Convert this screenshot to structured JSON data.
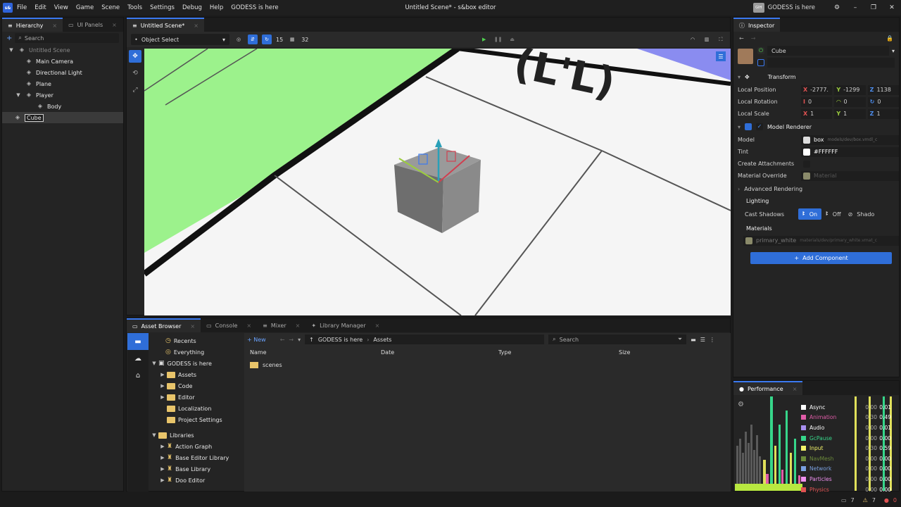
{
  "app": {
    "logo": "s&",
    "title": "Untitled Scene* - s&box editor",
    "user": "GODESS is here",
    "avatar": "GIH"
  },
  "menu": [
    "File",
    "Edit",
    "View",
    "Game",
    "Scene",
    "Tools",
    "Settings",
    "Debug",
    "Help",
    "GODESS is here"
  ],
  "hierarchy": {
    "tabs": [
      "Hierarchy",
      "UI Panels"
    ],
    "search_placeholder": "Search",
    "items": [
      {
        "label": "Untitled Scene"
      },
      {
        "label": "Main Camera"
      },
      {
        "label": "Directional Light"
      },
      {
        "label": "Plane"
      },
      {
        "label": "Player"
      },
      {
        "label": "Body"
      },
      {
        "label": "Cube"
      }
    ]
  },
  "viewport": {
    "tab": "Untitled Scene*",
    "mode": "Object Select",
    "snap": "15",
    "grid": "32"
  },
  "bottom": {
    "tabs": [
      "Asset Browser",
      "Console",
      "Mixer",
      "Library Manager"
    ],
    "new_label": "New",
    "path": [
      "GODESS is here",
      "Assets"
    ],
    "search_placeholder": "Search",
    "columns": [
      "Name",
      "Date",
      "Type",
      "Size"
    ],
    "files": [
      "scenes"
    ],
    "tree": {
      "recents": "Recents",
      "everything": "Everything",
      "project": "GODESS is here",
      "project_items": [
        "Assets",
        "Code",
        "Editor",
        "Localization",
        "Project Settings"
      ],
      "libraries": "Libraries",
      "library_items": [
        "Action Graph",
        "Base Editor Library",
        "Base Library",
        "Doo Editor"
      ]
    }
  },
  "inspector": {
    "tab": "Inspector",
    "object_name": "Cube",
    "transform": {
      "title": "Transform",
      "pos_label": "Local Position",
      "pos": [
        "-2777.",
        "-1299",
        "1138"
      ],
      "rot_label": "Local Rotation",
      "rot": [
        "0",
        "0",
        "0"
      ],
      "scale_label": "Local Scale",
      "scale": [
        "1",
        "1",
        "1"
      ]
    },
    "renderer": {
      "title": "Model Renderer",
      "model_label": "Model",
      "model_name": "box",
      "model_path": "models/dev/box.vmdl_c",
      "tint_label": "Tint",
      "tint": "#FFFFFF",
      "attach_label": "Create Attachments",
      "matov_label": "Material Override",
      "matov_placeholder": "Material",
      "advanced": "Advanced Rendering",
      "lighting": "Lighting",
      "shadows_label": "Cast Shadows",
      "shadow_on": "On",
      "shadow_off": "Off",
      "shadow_only": "Shado",
      "materials": "Materials",
      "material_name": "primary_white",
      "material_path": "materials/dev/primary_white.vmat_c"
    },
    "add_component": "Add Component"
  },
  "performance": {
    "tab": "Performance",
    "rows": [
      {
        "name": "Async",
        "color": "#ffffff",
        "a": "0.00",
        "b": "0.01"
      },
      {
        "name": "Animation",
        "color": "#e05ca8",
        "a": "0.30",
        "b": "0.49"
      },
      {
        "name": "Audio",
        "color": "#a88ff0",
        "a": "0.00",
        "b": "0.01"
      },
      {
        "name": "GcPause",
        "color": "#36d68a",
        "a": "0.00",
        "b": "0.00"
      },
      {
        "name": "Input",
        "color": "#f5f56a",
        "a": "0.30",
        "b": "0.59"
      },
      {
        "name": "NavMesh",
        "color": "#6b8a3a",
        "a": "0.00",
        "b": "0.00"
      },
      {
        "name": "Network",
        "color": "#7aa0e0",
        "a": "0.00",
        "b": "0.00"
      },
      {
        "name": "Particles",
        "color": "#f090f0",
        "a": "0.00",
        "b": "0.00"
      },
      {
        "name": "Physics",
        "color": "#e05252",
        "a": "0.00",
        "b": "0.00"
      }
    ]
  },
  "status": {
    "count1": "7",
    "count2": "7",
    "count3": "0"
  }
}
